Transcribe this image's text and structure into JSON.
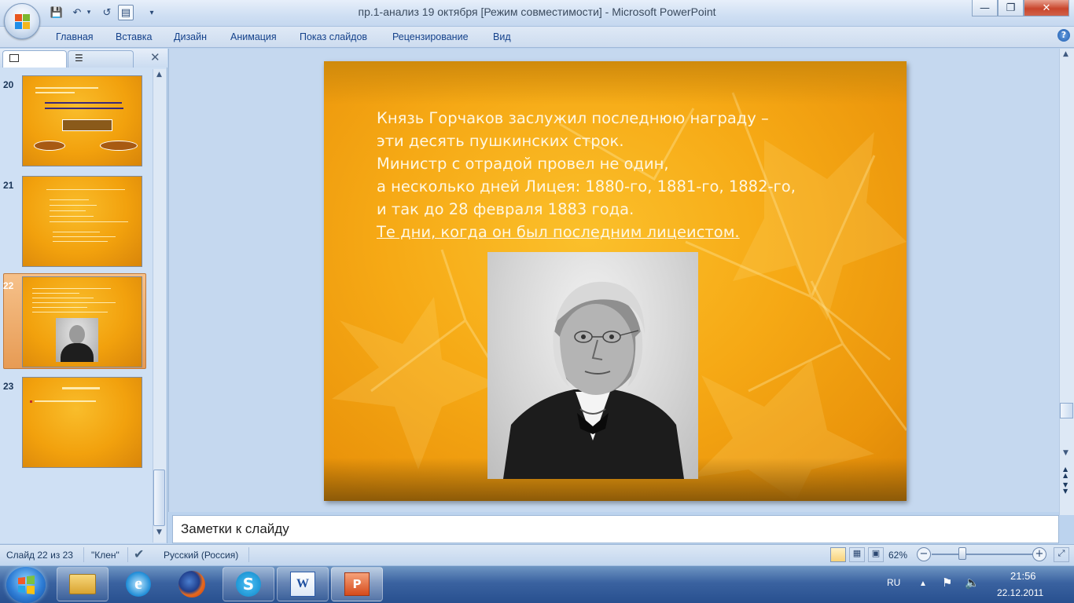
{
  "window": {
    "title": "пр.1-анализ 19 октября [Режим совместимости] - Microsoft PowerPoint",
    "buttons": {
      "minimize": "—",
      "maximize": "❐",
      "close": "✕"
    }
  },
  "quick_access": {
    "save": "💾",
    "undo": "↶",
    "undo_dd": "▾",
    "redo": "↺",
    "slide": "▤",
    "customize": "▾"
  },
  "ribbon": {
    "tabs": [
      "Главная",
      "Вставка",
      "Дизайн",
      "Анимация",
      "Показ слайдов",
      "Рецензирование",
      "Вид"
    ],
    "help": "?"
  },
  "slide_panel": {
    "close": "✕",
    "slides": [
      {
        "number": "20"
      },
      {
        "number": "21"
      },
      {
        "number": "22",
        "selected": true
      },
      {
        "number": "23"
      }
    ]
  },
  "slide": {
    "lines": [
      "Князь Горчаков заслужил последнюю награду –",
      "эти десять пушкинских строк.",
      " Министр с отрадой провел не один,",
      "а несколько дней Лицея: 1880-го, 1881-го, 1882-го,",
      "и так до 28 февраля 1883 года.",
      "Те дни, когда он был последним лицеистом."
    ]
  },
  "notes": {
    "placeholder": "Заметки к слайду"
  },
  "statusbar": {
    "slide_info": "Слайд 22 из 23",
    "theme": "\"Клен\"",
    "language": "Русский (Россия)",
    "zoom": "62%",
    "zoom_minus": "−",
    "zoom_plus": "+",
    "zoom_level": 0.62
  },
  "taskbar": {
    "lang": "RU",
    "time": "21:56",
    "date": "22.12.2011"
  },
  "colors": {
    "slide_bg": "#f6a915",
    "ribbon_text": "#15428b",
    "taskbar": "#3a62a0"
  }
}
